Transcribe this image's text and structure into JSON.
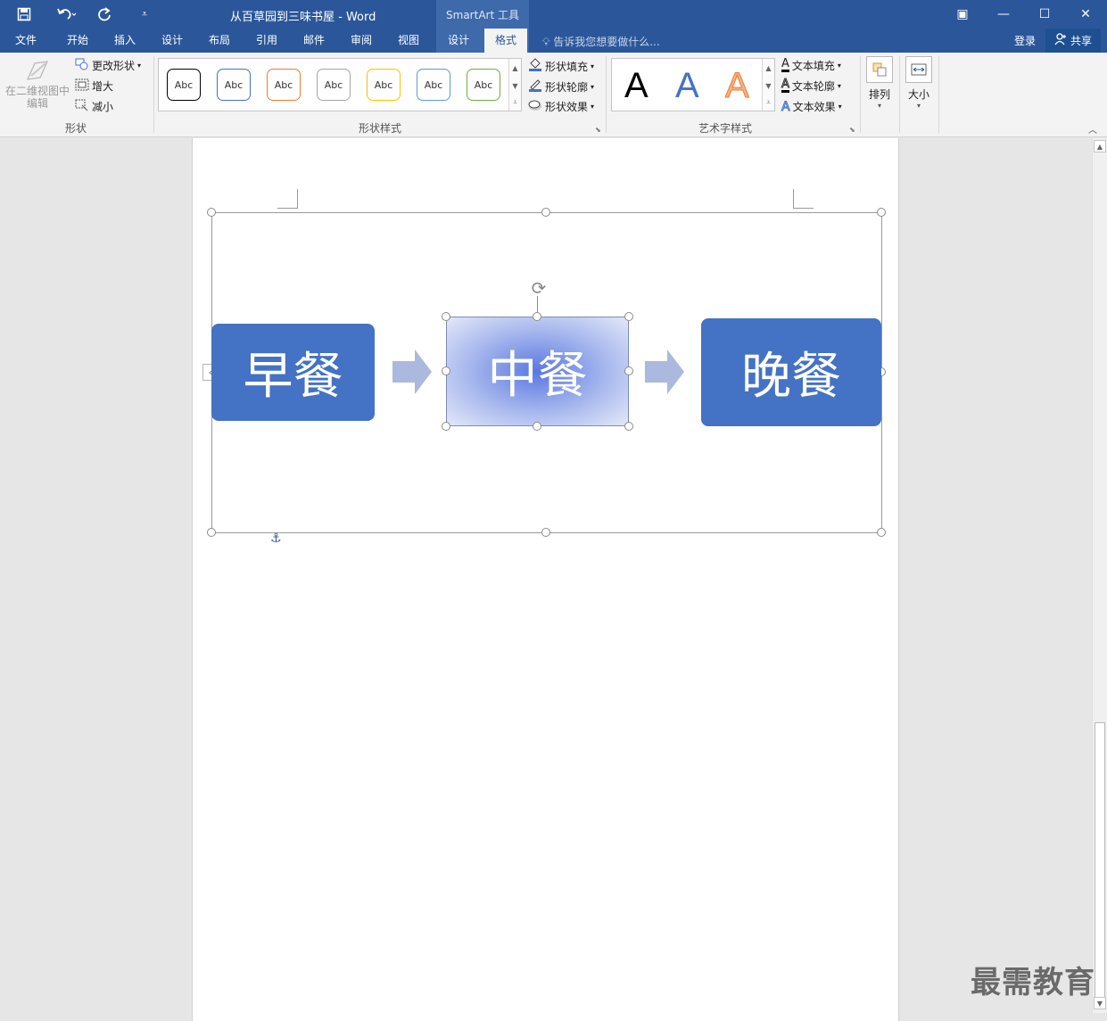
{
  "titlebar": {
    "doc_title": "从百草园到三味书屋 - Word",
    "context_header": "SmartArt 工具",
    "qat": {
      "save_icon": "save-icon",
      "undo_icon": "undo-icon",
      "redo_icon": "redo-icon",
      "customize_icon": "customize-qat-icon"
    },
    "window": {
      "restore_ribbon": "▣",
      "minimize": "—",
      "maximize": "☐",
      "close": "✕"
    }
  },
  "tabs": [
    {
      "label": "文件"
    },
    {
      "label": "开始"
    },
    {
      "label": "插入"
    },
    {
      "label": "设计"
    },
    {
      "label": "布局"
    },
    {
      "label": "引用"
    },
    {
      "label": "邮件"
    },
    {
      "label": "审阅"
    },
    {
      "label": "视图"
    },
    {
      "label": "设计"
    },
    {
      "label": "格式"
    }
  ],
  "active_tab": "格式",
  "tell_me": "告诉我您想要做什么...",
  "signin": "登录",
  "share": "共享",
  "ribbon": {
    "shapes_group": {
      "label": "形状",
      "edit_in_2d": "在二维视图中编辑",
      "change_shape": "更改形状",
      "larger": "增大",
      "smaller": "减小"
    },
    "shape_styles_group": {
      "label": "形状样式",
      "swatch_text": "Abc",
      "swatch_colors": [
        "#000000",
        "#4472c4",
        "#ed7d31",
        "#a5a5a5",
        "#ffc000",
        "#5b9bd5",
        "#70ad47"
      ],
      "fill": "形状填充",
      "outline": "形状轮廓",
      "effects": "形状效果"
    },
    "wordart_group": {
      "label": "艺术字样式",
      "sample": "A",
      "text_fill": "文本填充",
      "text_outline": "文本轮廓",
      "text_effects": "文本效果"
    },
    "arrange": "排列",
    "size": "大小"
  },
  "smartart": {
    "nodes": [
      {
        "text": "早餐",
        "fill": "#4472c4"
      },
      {
        "text": "中餐",
        "fill": "radial-gradient"
      },
      {
        "text": "晚餐",
        "fill": "#4472c4"
      }
    ],
    "arrow_color": "#aab9dd"
  },
  "watermark": "最需教育"
}
